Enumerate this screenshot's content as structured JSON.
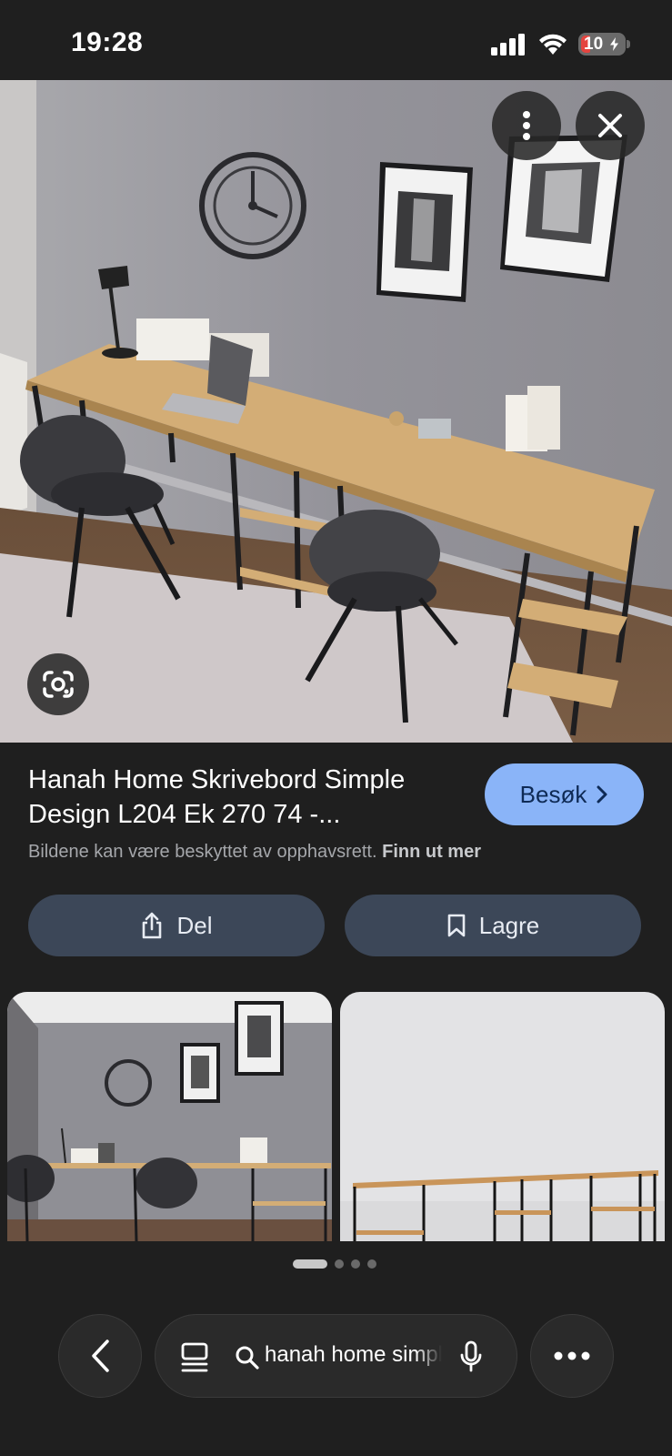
{
  "status_bar": {
    "time": "19:28",
    "battery": "10"
  },
  "image": {
    "icons": [
      "more-vert-icon",
      "close-icon",
      "google-lens-icon"
    ]
  },
  "result": {
    "title": "Hanah Home Skrivebord Simple Design L204 Ek 270 74 -...",
    "visit_label": "Besøk",
    "copyright_text": "Bildene kan være beskyttet av opphavsrett.",
    "learn_more": "Finn ut mer"
  },
  "actions": {
    "share_label": "Del",
    "save_label": "Lagre"
  },
  "pagination": {
    "pages": 4,
    "active": 1
  },
  "bottom_bar": {
    "query": "hanah home simple"
  },
  "colors": {
    "accent": "#8ab4f8",
    "action_bg": "#3c4758",
    "background": "#1f1f1f"
  }
}
